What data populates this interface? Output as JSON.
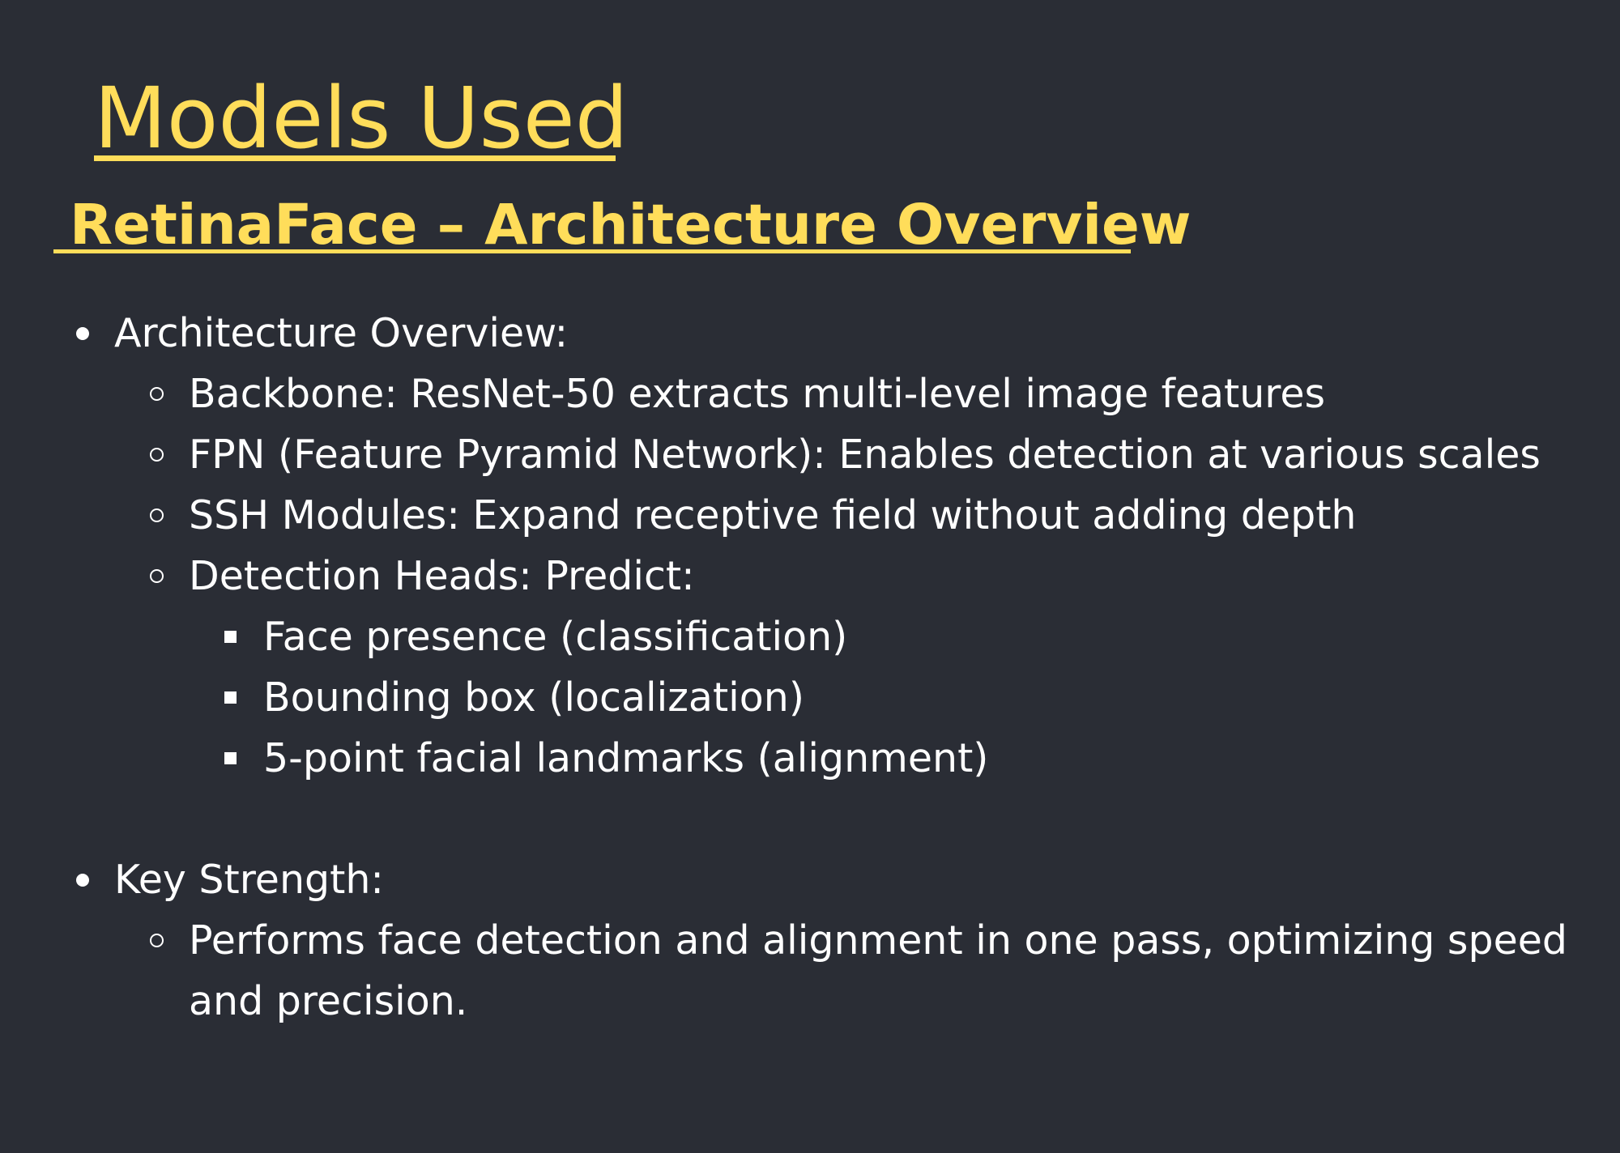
{
  "slide": {
    "title": "Models Used",
    "subtitle": "RetinaFace – Architecture Overview",
    "colors": {
      "background": "#2a2d35",
      "heading": "#ffdd5a",
      "text": "#ffffff"
    },
    "sections": [
      {
        "label": "Architecture Overview:",
        "items": [
          {
            "text": "Backbone: ResNet-50 extracts multi-level image features"
          },
          {
            "text": "FPN (Feature Pyramid Network): Enables detection at various scales"
          },
          {
            "text": "SSH Modules: Expand receptive field without adding depth"
          },
          {
            "text": "Detection Heads: Predict:",
            "subitems": [
              "Face presence (classification)",
              "Bounding box (localization)",
              "5-point facial landmarks (alignment)"
            ]
          }
        ]
      },
      {
        "label": "Key Strength:",
        "items": [
          {
            "text": "Performs face detection and alignment in one pass, optimizing speed",
            "continuation": "and precision."
          }
        ]
      }
    ]
  }
}
